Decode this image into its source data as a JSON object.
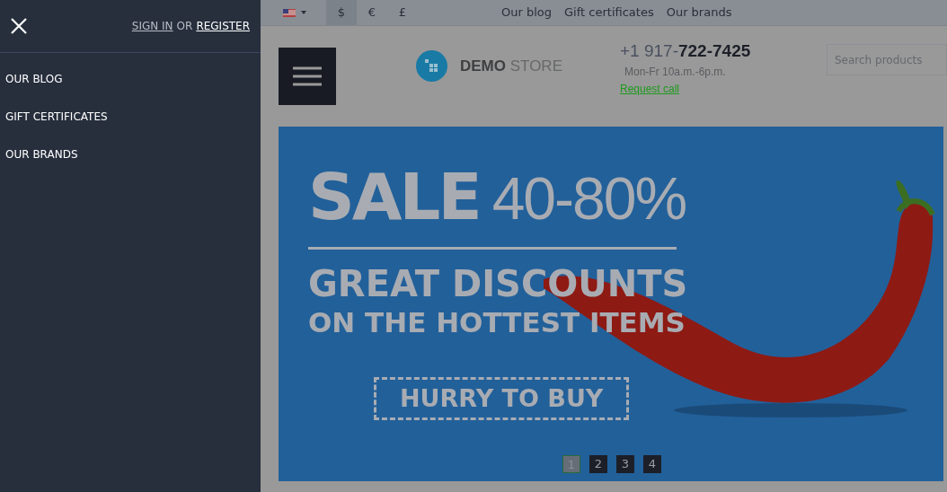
{
  "drawer": {
    "auth": {
      "sign_in": "SIGN IN",
      "or": "OR",
      "register": "REGISTER"
    },
    "items": [
      {
        "label": "OUR BLOG"
      },
      {
        "label": "GIFT CERTIFICATES"
      },
      {
        "label": "OUR BRANDS"
      }
    ]
  },
  "topbar": {
    "currencies": [
      {
        "label": "$",
        "selected": true
      },
      {
        "label": "€",
        "selected": false
      },
      {
        "label": "£",
        "selected": false
      }
    ],
    "links": [
      "Our blog",
      "Gift certificates",
      "Our brands"
    ]
  },
  "header": {
    "logo": {
      "bold": "DEMO",
      "light": "STORE"
    },
    "phone": {
      "prefix": "+1 917-",
      "number": "722-7425"
    },
    "hours": "Mon-Fr 10a.m.-6p.m.",
    "request_call": "Request call",
    "search": {
      "placeholder": "Search products"
    }
  },
  "banner": {
    "sale": "SALE",
    "discount": "40-80%",
    "line1": "GREAT DISCOUNTS",
    "line2": "ON THE HOTTEST ITEMS",
    "button": "HURRY TO BUY",
    "pages": [
      {
        "label": "1",
        "selected": true
      },
      {
        "label": "2",
        "selected": false
      },
      {
        "label": "3",
        "selected": false
      },
      {
        "label": "4",
        "selected": false
      }
    ]
  }
}
